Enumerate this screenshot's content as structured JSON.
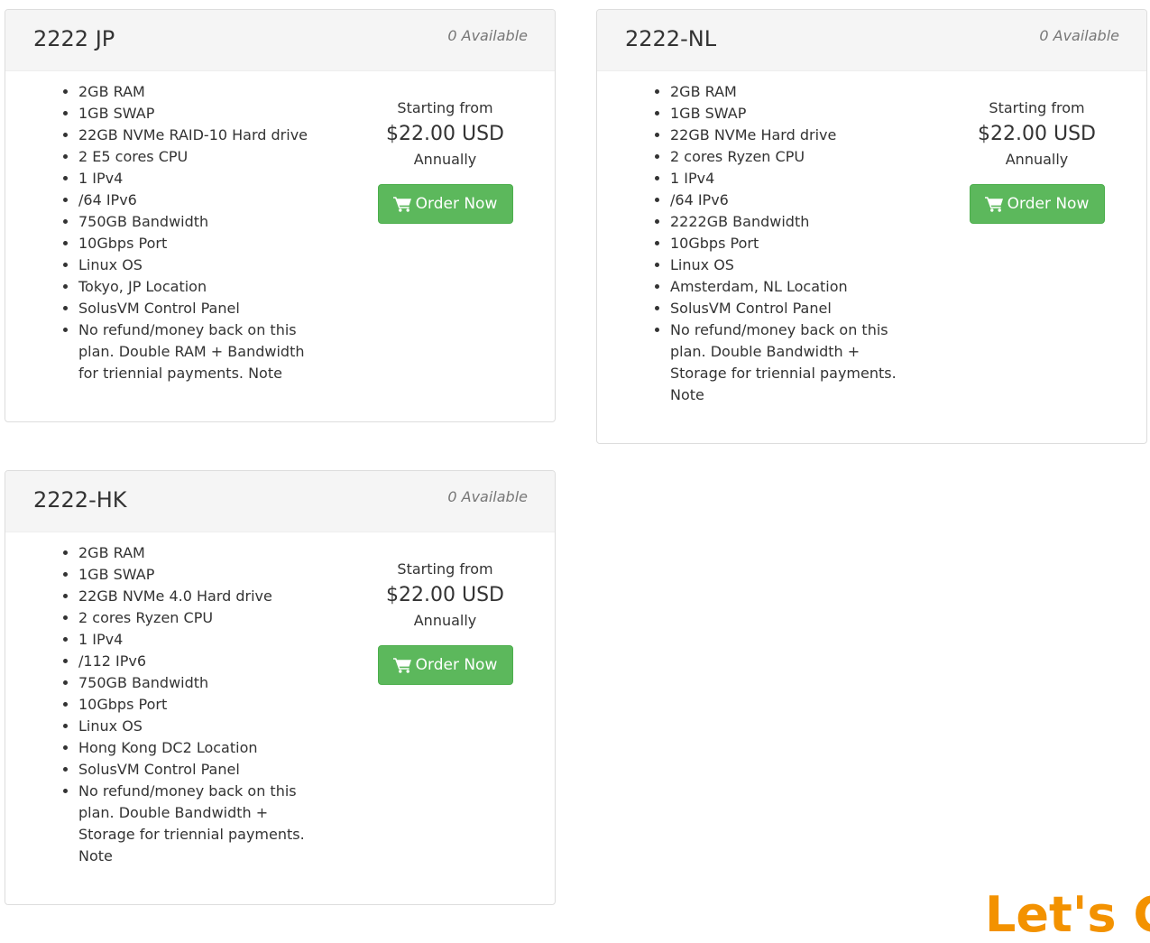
{
  "plans": [
    {
      "title": "2222 JP",
      "availability": "0 Available",
      "features": [
        "2GB RAM",
        "1GB SWAP",
        "22GB NVMe RAID-10 Hard drive",
        "2 E5 cores CPU",
        "1 IPv4",
        "/64 IPv6",
        "750GB Bandwidth",
        "10Gbps Port",
        "Linux OS",
        "Tokyo, JP Location",
        "SolusVM Control Panel",
        "No refund/money back on this plan. Double RAM + Bandwidth for triennial payments. Note"
      ],
      "price_prefix": "Starting from",
      "price": "$22.00 USD",
      "cycle": "Annually",
      "order_label": "Order Now"
    },
    {
      "title": "2222-NL",
      "availability": "0 Available",
      "features": [
        "2GB RAM",
        "1GB SWAP",
        "22GB NVMe Hard drive",
        "2 cores Ryzen CPU",
        "1 IPv4",
        "/64 IPv6",
        "2222GB Bandwidth",
        "10Gbps Port",
        "Linux OS",
        "Amsterdam, NL Location",
        "SolusVM Control Panel",
        "No refund/money back on this plan. Double Bandwidth + Storage for triennial payments. Note"
      ],
      "price_prefix": "Starting from",
      "price": "$22.00 USD",
      "cycle": "Annually",
      "order_label": "Order Now"
    },
    {
      "title": "2222-HK",
      "availability": "0 Available",
      "features": [
        "2GB RAM",
        "1GB SWAP",
        "22GB NVMe 4.0 Hard drive",
        "2 cores Ryzen CPU",
        "1 IPv4",
        "/112 IPv6",
        "750GB Bandwidth",
        "10Gbps Port",
        "Linux OS",
        "Hong Kong DC2 Location",
        "SolusVM Control Panel",
        "No refund/money back on this plan. Double Bandwidth + Storage for triennial payments. Note"
      ],
      "price_prefix": "Starting from",
      "price": "$22.00 USD",
      "cycle": "Annually",
      "order_label": "Order Now"
    }
  ],
  "icons": {
    "order_button": "shopping-cart-icon"
  },
  "colors": {
    "order_button": "#5cb85c",
    "header_background": "#f5f5f5",
    "availability_text": "#777777",
    "logo_accent": "#f39200"
  },
  "footer_logo_fragment": "Let's Cl"
}
